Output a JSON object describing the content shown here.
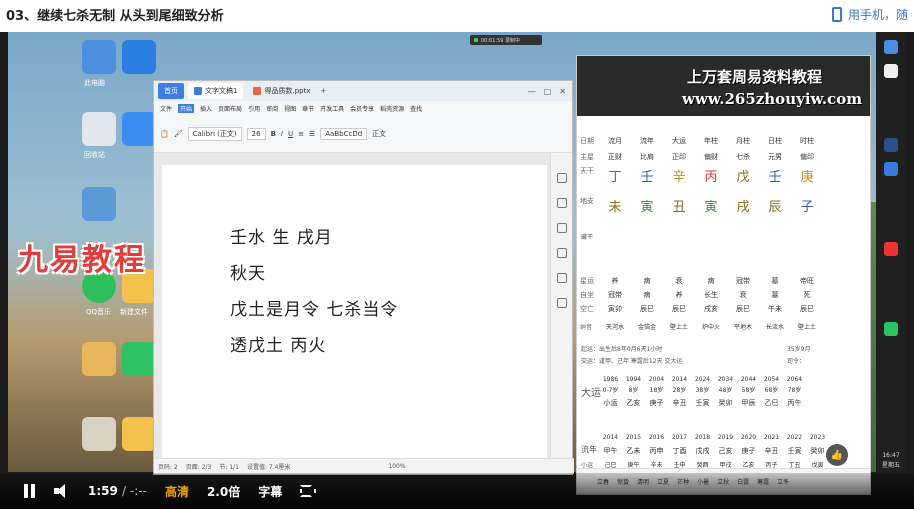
{
  "page": {
    "title": "03、继续七杀无制 从头到尾细致分析",
    "phone_link": "用手机，随"
  },
  "desktop": {
    "icons": [
      "此电脑",
      "回收站",
      "QQ音乐",
      "新建文件"
    ],
    "watermark_jiuyi": "九易教程",
    "record_badge": "00:01:59 录制中"
  },
  "wps": {
    "tabs": [
      {
        "label": "首页"
      },
      {
        "label": "文字文稿1"
      },
      {
        "label": "得品质数.pptx"
      }
    ],
    "menu": [
      "文件",
      "开始",
      "插入",
      "页面布局",
      "引用",
      "审阅",
      "视图",
      "章节",
      "开发工具",
      "会员专享",
      "稻壳资源",
      "查找"
    ],
    "menu_active": "开始",
    "font_name": "Calibri (正文)",
    "font_size": "26",
    "style_label": "正文",
    "style_preview": "AaBbCcDd",
    "doc_lines": [
      "壬水 生 戌月",
      "秋天",
      "戊土是月令 七杀当令",
      "透戊土 丙火"
    ],
    "status": {
      "page": "页码: 2",
      "pages": "页面: 2/3",
      "section": "节: 1/1",
      "setting": "设置值: 7.4厘米",
      "zoom": "100%"
    }
  },
  "bazi": {
    "watermark_title": "上万套周易资料教程",
    "watermark_url": "www.265zhouyiw.com",
    "header_labels": [
      "日期",
      "流月",
      "流年",
      "大运",
      "年柱",
      "月柱",
      "日柱",
      "时柱"
    ],
    "zhuxing": [
      "主星",
      "正财",
      "比肩",
      "正印",
      "偏财",
      "七杀",
      "元男",
      "偏印"
    ],
    "tiangan": [
      "天干",
      "丁",
      "壬",
      "辛",
      "丙",
      "戊",
      "壬",
      "庚"
    ],
    "dizhi": [
      "地支",
      "未",
      "寅",
      "丑",
      "寅",
      "戌",
      "辰",
      "子"
    ],
    "canggan_label": "藏干",
    "xingyun": [
      "星运",
      "养",
      "病",
      "衰",
      "病",
      "冠带",
      "墓",
      "帝旺"
    ],
    "zizuo": [
      "自坐",
      "冠带",
      "病",
      "养",
      "长生",
      "衰",
      "墓",
      "死"
    ],
    "kongwang": [
      "空亡",
      "寅卯",
      "辰巳",
      "辰巳",
      "戌亥",
      "辰巳",
      "午未",
      "辰巳"
    ],
    "nayin": [
      "纳音",
      "天河水",
      "金箔金",
      "壁上土",
      "炉中火",
      "平地木",
      "长流水",
      "壁上土"
    ],
    "qiyun": "起运：出生后8年0月6天1小时",
    "jiaoyun": "交运：逢甲、己年 寒露后12天 交大运",
    "age_info": "35岁9月",
    "siling": "司令：",
    "dayun_label": "大运",
    "dayun_years": [
      "1986",
      "1994",
      "2004",
      "2014",
      "2024",
      "2034",
      "2044",
      "2054",
      "2064"
    ],
    "dayun_ages": [
      "0-7岁",
      "8岁",
      "18岁",
      "28岁",
      "38岁",
      "48岁",
      "58岁",
      "68岁",
      "78岁"
    ],
    "dayun_gz": [
      "小运",
      "乙亥",
      "庚子",
      "辛丑",
      "壬寅",
      "癸卯",
      "甲辰",
      "乙巳",
      "丙午"
    ],
    "liunian_label": "流年",
    "liunian_years": [
      "2014",
      "2015",
      "2016",
      "2017",
      "2018",
      "2019",
      "2020",
      "2021",
      "2022",
      "2023"
    ],
    "liunian_gz": [
      "甲午",
      "乙未",
      "丙申",
      "丁酉",
      "戊戌",
      "己亥",
      "庚子",
      "辛丑",
      "壬寅",
      "癸卯"
    ],
    "xiaoyun_label": "小运",
    "xiaoyun": [
      "己巳",
      "庚午",
      "辛未",
      "壬申",
      "癸酉",
      "甲戌",
      "乙亥",
      "丙子",
      "丁丑",
      "戊寅"
    ],
    "bottom_terms": [
      "立春",
      "惊蛰",
      "清明",
      "立夏",
      "芒种",
      "小暑",
      "立秋",
      "白露",
      "寒露",
      "立冬"
    ]
  },
  "player": {
    "current_time": "1:59",
    "duration": "/ -:--",
    "quality": "高清",
    "speed": "2.0倍",
    "subtitle": "字幕"
  },
  "taskbar": {
    "time": "16:47",
    "weekday": "星期五"
  },
  "colors": {
    "wps_blue": "#3c7ee4",
    "quality_orange": "#f0a500",
    "fire_red": "#d63b2b",
    "wood_green": "#2e8b3a",
    "earth_brown": "#8a6a1c",
    "water_blue": "#2a62c9"
  }
}
